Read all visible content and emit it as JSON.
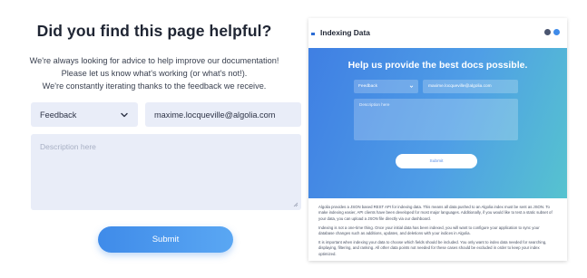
{
  "feedback_form": {
    "title": "Did you find this page helpful?",
    "intro_lines": [
      "We're always looking for advice to help improve our documentation!",
      "Please let us know what's working (or what's not!).",
      "We're constantly iterating thanks to the feedback we receive."
    ],
    "type_select": {
      "value": "Feedback"
    },
    "email_field": {
      "value": "maxime.locqueville@algolia.com"
    },
    "description": {
      "placeholder": "Description here"
    },
    "submit_label": "Submit"
  },
  "preview": {
    "header": {
      "title": "Indexing Data",
      "icons": [
        "github-icon",
        "user-avatar-icon"
      ]
    },
    "banner": {
      "headline": "Help us provide the best docs possible.",
      "select_value": "Feedback",
      "email_value": "maxime.locqueville@algolia.com",
      "description_placeholder": "Description here",
      "submit_label": "Submit"
    },
    "paragraphs": [
      "Algolia provides a JSON based REST API for indexing data. This means all data pushed to an Algolia index must be sent as JSON. To make indexing easier, API clients have been developed for most major languages. Additionally, if you would like to test a static subset of your data, you can upload a JSON file directly via our dashboard.",
      "Indexing is not a one-time thing. Once your initial data has been indexed, you will want to configure your application to sync your database changes such as additions, updates, and deletions with your indices in Algolia.",
      "It is important when indexing your data to choose which fields should be included. You only want to index data needed for searching, displaying, filtering, and ranking. All other data points not needed for these cases should be excluded in order to keep your index optimized."
    ]
  },
  "colors": {
    "input_bg": "#e9edf8",
    "submit_gradient_start": "#3f8be9",
    "submit_gradient_end": "#5aa7f3",
    "banner_gradient_start": "#3f7fe3",
    "banner_gradient_end": "#56c3cf"
  }
}
